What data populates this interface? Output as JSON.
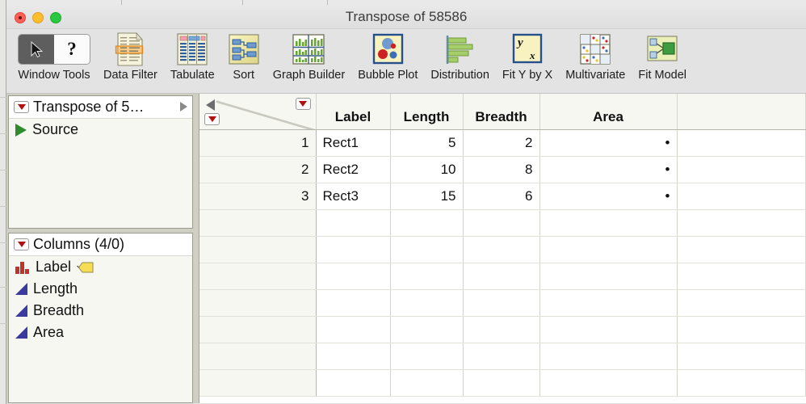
{
  "window": {
    "title": "Transpose of 58586",
    "controls": [
      {
        "name": "close",
        "color": "#ff5f57"
      },
      {
        "name": "minimize",
        "color": "#ffbd2e"
      },
      {
        "name": "zoom",
        "color": "#28c940"
      }
    ]
  },
  "toolbar": {
    "items": [
      {
        "label": "Window Tools",
        "icon": "arrow-question-tool"
      },
      {
        "label": "Data Filter",
        "icon": "data-filter-icon"
      },
      {
        "label": "Tabulate",
        "icon": "tabulate-icon"
      },
      {
        "label": "Sort",
        "icon": "sort-icon"
      },
      {
        "label": "Graph Builder",
        "icon": "graph-builder-icon"
      },
      {
        "label": "Bubble Plot",
        "icon": "bubble-plot-icon"
      },
      {
        "label": "Distribution",
        "icon": "distribution-icon"
      },
      {
        "label": "Fit Y by X",
        "icon": "fit-y-by-x-icon"
      },
      {
        "label": "Multivariate",
        "icon": "multivariate-icon"
      },
      {
        "label": "Fit Model",
        "icon": "fit-model-icon"
      }
    ],
    "tool_question_glyph": "?"
  },
  "sidebar": {
    "tables_panel": {
      "title": "Transpose of 5…",
      "entries": [
        {
          "label": "Source",
          "icon": "green-play-icon"
        }
      ]
    },
    "columns_panel": {
      "title": "Columns (4/0)",
      "entries": [
        {
          "label": "Label",
          "icon": "nominal-bars-icon",
          "extra_icon": "label-tag-icon"
        },
        {
          "label": "Length",
          "icon": "continuous-triangle-icon"
        },
        {
          "label": "Breadth",
          "icon": "continuous-triangle-icon"
        },
        {
          "label": "Area",
          "icon": "continuous-triangle-icon"
        }
      ]
    }
  },
  "table": {
    "columns": [
      "Label",
      "Length",
      "Breadth",
      "Area"
    ],
    "row_numbers": [
      "1",
      "2",
      "3"
    ],
    "rows": [
      {
        "Label": "Rect1",
        "Length": "5",
        "Breadth": "2",
        "Area": "•"
      },
      {
        "Label": "Rect2",
        "Length": "10",
        "Breadth": "8",
        "Area": "•"
      },
      {
        "Label": "Rect3",
        "Length": "15",
        "Breadth": "6",
        "Area": "•"
      }
    ],
    "empty_row_count": 7,
    "missing_value_glyph": "•"
  },
  "colors": {
    "window_chrome": "#e3e3e3",
    "sidebar_bg": "#cfcfc4",
    "panel_bg": "#f7f7f2",
    "red_triangle": "#b01010",
    "green_triangle": "#2e8b2e",
    "blue_triangle": "#3b3b9e",
    "nominal_red": "#c1322a"
  }
}
